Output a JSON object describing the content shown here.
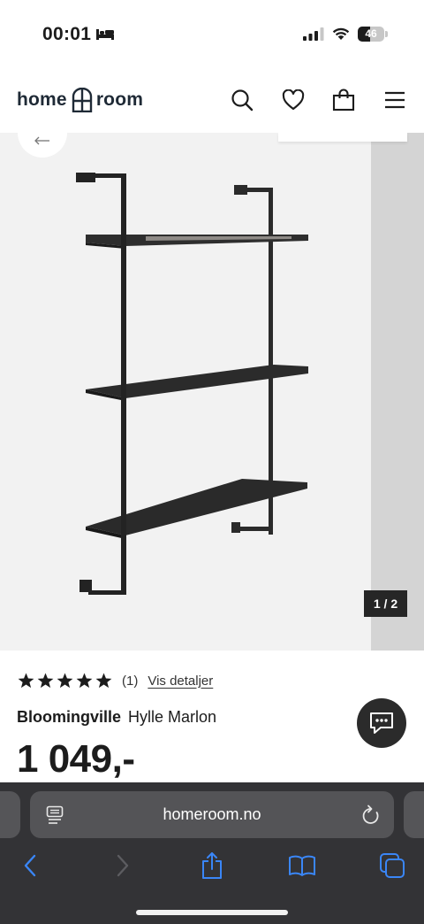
{
  "status_bar": {
    "time": "00:01",
    "focus_icon": "bed-icon",
    "battery_percent": 46,
    "battery_label": "46"
  },
  "header": {
    "logo_left": "home",
    "logo_right": "room",
    "icons": [
      "search-icon",
      "heart-icon",
      "bag-icon",
      "menu-icon"
    ]
  },
  "gallery": {
    "counter": "1 / 2"
  },
  "product": {
    "rating": 5,
    "review_count": "(1)",
    "details_link": "Vis detaljer",
    "brand": "Bloomingville",
    "name": "Hylle Marlon",
    "price": "1 049,-"
  },
  "browser": {
    "url": "homeroom.no",
    "toolbar_icons": [
      "back-icon",
      "forward-icon",
      "share-icon",
      "bookmarks-icon",
      "tabs-icon"
    ],
    "accent": "#3a86f7"
  }
}
